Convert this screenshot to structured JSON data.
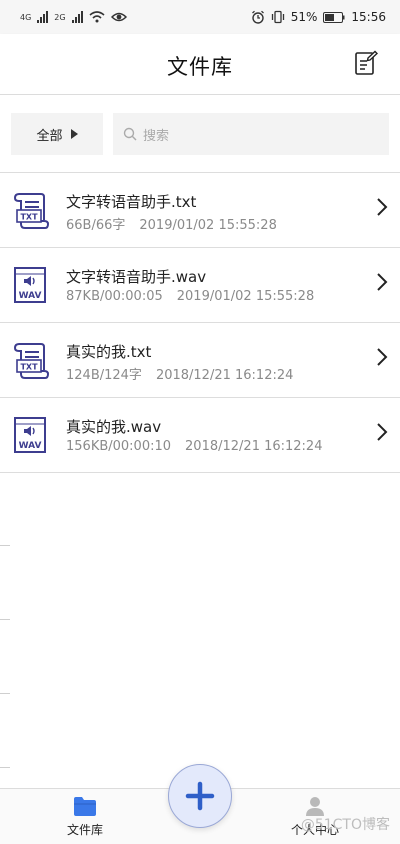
{
  "status_bar": {
    "left_tags": [
      "4G",
      "2G"
    ],
    "battery": "51%",
    "time": "15:56"
  },
  "header": {
    "title": "文件库",
    "edit_icon": "edit-note-icon"
  },
  "filter": {
    "all_label": "全部",
    "search_placeholder": "搜索"
  },
  "files": [
    {
      "name": "文字转语音助手.txt",
      "meta": "66B/66字",
      "date": "2019/01/02 15:55:28",
      "type": "TXT"
    },
    {
      "name": "文字转语音助手.wav",
      "meta": "87KB/00:00:05",
      "date": "2019/01/02 15:55:28",
      "type": "WAV"
    },
    {
      "name": "真实的我.txt",
      "meta": "124B/124字",
      "date": "2018/12/21 16:12:24",
      "type": "TXT"
    },
    {
      "name": "真实的我.wav",
      "meta": "156KB/00:00:10",
      "date": "2018/12/21 16:12:24",
      "type": "WAV"
    }
  ],
  "bottom_nav": {
    "library_label": "文件库",
    "profile_label": "个人中心"
  },
  "watermark": "@51CTO博客",
  "colors": {
    "accent": "#3a78e8",
    "icon_purple": "#3d3d8f",
    "fab_bg": "#e3e9fb"
  }
}
